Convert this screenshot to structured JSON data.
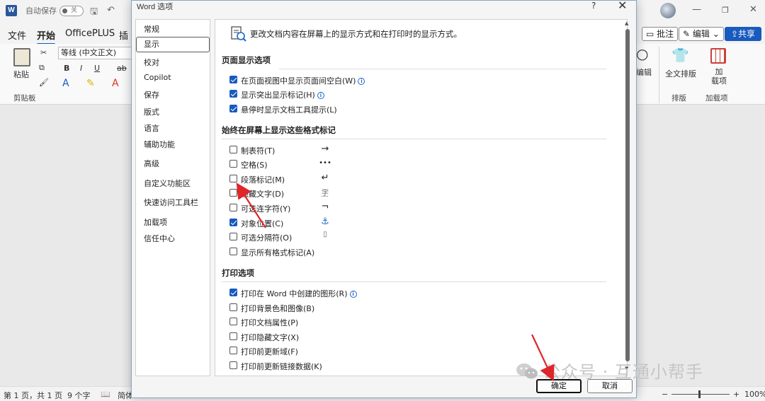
{
  "titlebar": {
    "app_icon": "W",
    "autosave_label": "自动保存",
    "autosave_state": "关",
    "window_controls": [
      "—",
      "❐",
      "✕"
    ]
  },
  "menubar": {
    "tabs": [
      "文件",
      "开始",
      "OfficePLUS",
      "插"
    ],
    "active_tab": "开始",
    "comment_label": "批注",
    "edit_label": "编辑",
    "share_label": "共享"
  },
  "ribbon": {
    "paste_label": "粘贴",
    "font_name": "等线 (中文正文)",
    "clipboard_group": "剪贴板",
    "find_label": "编辑",
    "fulltext_label": "全文排版",
    "addin_label": "加\n载项",
    "layout_group": "排版",
    "addin_group": "加载项"
  },
  "statusbar": {
    "page": "第 1 页，共 1 页",
    "words": "9 个字",
    "lang": "简体",
    "zoom": "100%"
  },
  "dialog": {
    "title": "Word 选项",
    "help": "?",
    "close": "✕",
    "nav": [
      {
        "label": "常规",
        "selected": false
      },
      {
        "label": "显示",
        "selected": true
      },
      {
        "label": "校对",
        "selected": false
      },
      {
        "label": "Copilot",
        "selected": false
      },
      {
        "label": "保存",
        "selected": false
      },
      {
        "label": "版式",
        "selected": false
      },
      {
        "label": "语言",
        "selected": false
      },
      {
        "label": "辅助功能",
        "selected": false
      },
      {
        "label": "高级",
        "selected": false
      },
      {
        "label": "自定义功能区",
        "selected": false
      },
      {
        "label": "快速访问工具栏",
        "selected": false
      },
      {
        "label": "加载项",
        "selected": false
      },
      {
        "label": "信任中心",
        "selected": false
      }
    ],
    "intro": "更改文档内容在屏幕上的显示方式和在打印时的显示方式。",
    "page_display": {
      "title": "页面显示选项",
      "options": [
        {
          "label": "在页面视图中显示页面间空白(W)",
          "checked": true,
          "info": true
        },
        {
          "label": "显示突出显示标记(H)",
          "checked": true,
          "info": true
        },
        {
          "label": "悬停时显示文档工具提示(L)",
          "checked": true,
          "info": false
        }
      ]
    },
    "format_marks": {
      "title": "始终在屏幕上显示这些格式标记",
      "options": [
        {
          "label": "制表符(T)",
          "checked": false,
          "mark": "→"
        },
        {
          "label": "空格(S)",
          "checked": false,
          "mark": "•••"
        },
        {
          "label": "段落标记(M)",
          "checked": false,
          "mark": "↵"
        },
        {
          "label": "隐藏文字(D)",
          "checked": false,
          "mark": "字"
        },
        {
          "label": "可选连字符(Y)",
          "checked": false,
          "mark": "¬"
        },
        {
          "label": "对象位置(C)",
          "checked": true,
          "mark": "⚓"
        },
        {
          "label": "可选分隔符(O)",
          "checked": false,
          "mark": "▯"
        },
        {
          "label": "显示所有格式标记(A)",
          "checked": false,
          "mark": ""
        }
      ]
    },
    "print": {
      "title": "打印选项",
      "options": [
        {
          "label": "打印在 Word 中创建的图形(R)",
          "checked": true,
          "info": true
        },
        {
          "label": "打印背景色和图像(B)",
          "checked": false,
          "info": false
        },
        {
          "label": "打印文档属性(P)",
          "checked": false,
          "info": false
        },
        {
          "label": "打印隐藏文字(X)",
          "checked": false,
          "info": false
        },
        {
          "label": "打印前更新域(F)",
          "checked": false,
          "info": false
        },
        {
          "label": "打印前更新链接数据(K)",
          "checked": false,
          "info": false
        }
      ]
    },
    "ok_label": "确定",
    "cancel_label": "取消"
  },
  "watermark": "公众号 · 互通小帮手",
  "colors": {
    "accent": "#185abd",
    "annotation_arrow": "#e0252b"
  }
}
